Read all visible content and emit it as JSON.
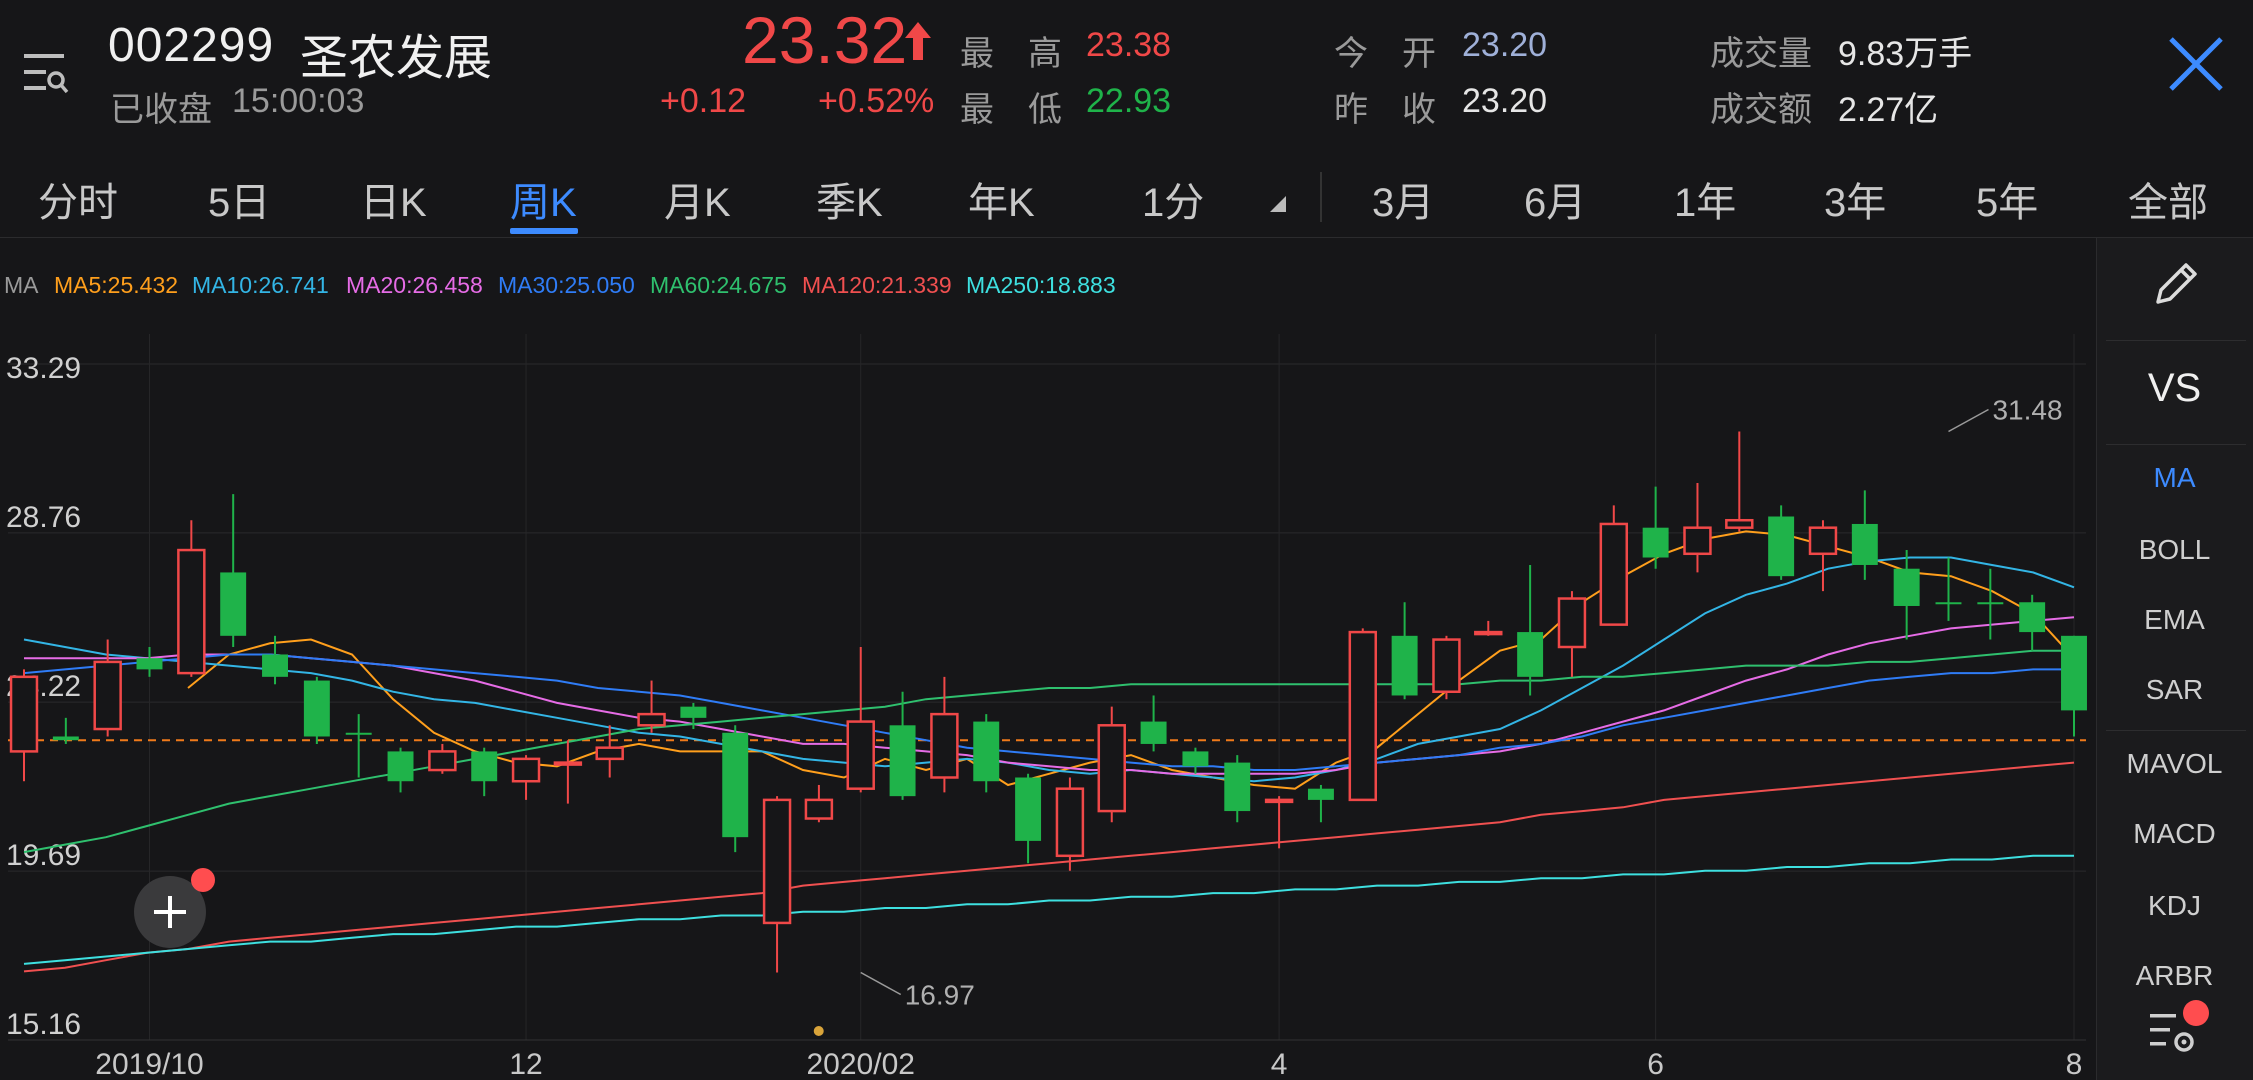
{
  "header": {
    "code": "002299",
    "name": "圣农发展",
    "status": "已收盘",
    "time": "15:00:03",
    "price": "23.32",
    "change": "+0.12",
    "change_pct": "+0.52%",
    "high_label": "最　高",
    "high": "23.38",
    "low_label": "最　低",
    "low": "22.93",
    "open_label": "今　开",
    "open": "23.20",
    "prev_close_label": "昨　收",
    "prev_close": "23.20",
    "volume_label": "成交量",
    "volume": "9.83万手",
    "amount_label": "成交额",
    "amount": "2.27亿"
  },
  "tabs": [
    "分时",
    "5日",
    "日K",
    "周K",
    "月K",
    "季K",
    "年K",
    "1分"
  ],
  "active_tab": "周K",
  "ranges": [
    "3月",
    "6月",
    "1年",
    "3年",
    "5年",
    "全部"
  ],
  "ma_legend": {
    "prefix": "MA",
    "items": [
      {
        "label": "MA5:25.432",
        "color": "#ff9f1c"
      },
      {
        "label": "MA10:26.741",
        "color": "#33b5e5"
      },
      {
        "label": "MA20:26.458",
        "color": "#e66ce6"
      },
      {
        "label": "MA30:25.050",
        "color": "#2f7cf6"
      },
      {
        "label": "MA60:24.675",
        "color": "#2fc06e"
      },
      {
        "label": "MA120:21.339",
        "color": "#f05050"
      },
      {
        "label": "MA250:18.883",
        "color": "#3ee0e0"
      }
    ]
  },
  "side_panel": {
    "vs": "VS",
    "indicators": [
      "MA",
      "BOLL",
      "EMA",
      "SAR",
      "MAVOL",
      "MACD",
      "KDJ",
      "ARBR"
    ],
    "active": "MA"
  },
  "colors": {
    "up": "#f04848",
    "down": "#1fb34a",
    "accent": "#3d8bff",
    "background": "#161618"
  },
  "chart_data": {
    "type": "candlestick",
    "y_ticks": [
      "33.29",
      "28.76",
      "24.22",
      "19.69",
      "15.16"
    ],
    "ylim": [
      15.16,
      33.29
    ],
    "x_ticks": [
      {
        "label": "2019/10",
        "index": 3
      },
      {
        "label": "12",
        "index": 12
      },
      {
        "label": "2020/02",
        "index": 20
      },
      {
        "label": "4",
        "index": 30
      },
      {
        "label": "6",
        "index": 39
      },
      {
        "label": "8",
        "index": 49
      }
    ],
    "reference_price": 23.2,
    "annotations": [
      {
        "text": "31.48",
        "index": 46,
        "value": 31.48
      },
      {
        "text": "16.97",
        "index": 20,
        "value": 16.97
      }
    ],
    "candles": [
      {
        "o": 22.9,
        "c": 24.9,
        "h": 25.1,
        "l": 22.1
      },
      {
        "o": 23.3,
        "c": 23.2,
        "h": 23.8,
        "l": 23.1
      },
      {
        "o": 23.5,
        "c": 25.3,
        "h": 25.9,
        "l": 23.3
      },
      {
        "o": 25.4,
        "c": 25.1,
        "h": 25.7,
        "l": 24.9
      },
      {
        "o": 25.0,
        "c": 28.3,
        "h": 29.1,
        "l": 24.9
      },
      {
        "o": 27.7,
        "c": 26.0,
        "h": 29.8,
        "l": 25.7
      },
      {
        "o": 25.5,
        "c": 24.9,
        "h": 26.0,
        "l": 24.7
      },
      {
        "o": 24.8,
        "c": 23.3,
        "h": 24.9,
        "l": 23.1
      },
      {
        "o": 23.4,
        "c": 23.35,
        "h": 23.9,
        "l": 22.2
      },
      {
        "o": 22.9,
        "c": 22.1,
        "h": 23.0,
        "l": 21.8
      },
      {
        "o": 22.4,
        "c": 22.9,
        "h": 23.1,
        "l": 22.3
      },
      {
        "o": 22.9,
        "c": 22.1,
        "h": 23.0,
        "l": 21.7
      },
      {
        "o": 22.1,
        "c": 22.7,
        "h": 22.8,
        "l": 21.6
      },
      {
        "o": 22.6,
        "c": 22.6,
        "h": 23.2,
        "l": 21.5
      },
      {
        "o": 22.7,
        "c": 23.0,
        "h": 23.6,
        "l": 22.2
      },
      {
        "o": 23.6,
        "c": 23.9,
        "h": 24.8,
        "l": 23.4
      },
      {
        "o": 24.1,
        "c": 23.8,
        "h": 24.2,
        "l": 23.5
      },
      {
        "o": 23.4,
        "c": 20.6,
        "h": 23.6,
        "l": 20.2
      },
      {
        "o": 18.3,
        "c": 21.6,
        "h": 21.7,
        "l": 16.97
      },
      {
        "o": 21.1,
        "c": 21.6,
        "h": 22.0,
        "l": 21.0
      },
      {
        "o": 21.9,
        "c": 23.7,
        "h": 25.7,
        "l": 21.8
      },
      {
        "o": 23.6,
        "c": 21.7,
        "h": 24.5,
        "l": 21.6
      },
      {
        "o": 22.2,
        "c": 23.9,
        "h": 24.9,
        "l": 21.8
      },
      {
        "o": 23.7,
        "c": 22.1,
        "h": 23.9,
        "l": 21.8
      },
      {
        "o": 22.2,
        "c": 20.5,
        "h": 22.3,
        "l": 19.9
      },
      {
        "o": 20.1,
        "c": 21.9,
        "h": 22.2,
        "l": 19.7
      },
      {
        "o": 21.3,
        "c": 23.6,
        "h": 24.1,
        "l": 21.0
      },
      {
        "o": 23.7,
        "c": 23.1,
        "h": 24.4,
        "l": 22.9
      },
      {
        "o": 22.9,
        "c": 22.5,
        "h": 23.0,
        "l": 22.3
      },
      {
        "o": 22.6,
        "c": 21.3,
        "h": 22.8,
        "l": 21.0
      },
      {
        "o": 21.6,
        "c": 21.6,
        "h": 21.7,
        "l": 20.3
      },
      {
        "o": 21.9,
        "c": 21.6,
        "h": 22.0,
        "l": 21.0
      },
      {
        "o": 21.6,
        "c": 26.1,
        "h": 26.2,
        "l": 21.6
      },
      {
        "o": 26.0,
        "c": 24.4,
        "h": 26.9,
        "l": 24.3
      },
      {
        "o": 24.5,
        "c": 25.9,
        "h": 26.0,
        "l": 24.3
      },
      {
        "o": 26.1,
        "c": 26.1,
        "h": 26.4,
        "l": 26.0
      },
      {
        "o": 26.1,
        "c": 24.9,
        "h": 27.9,
        "l": 24.4
      },
      {
        "o": 25.7,
        "c": 27.0,
        "h": 27.2,
        "l": 24.9
      },
      {
        "o": 26.3,
        "c": 29.0,
        "h": 29.5,
        "l": 26.6
      },
      {
        "o": 28.9,
        "c": 28.1,
        "h": 30.0,
        "l": 27.8
      },
      {
        "o": 28.2,
        "c": 28.9,
        "h": 30.1,
        "l": 27.7
      },
      {
        "o": 28.9,
        "c": 29.1,
        "h": 31.48,
        "l": 28.8
      },
      {
        "o": 29.2,
        "c": 27.6,
        "h": 29.5,
        "l": 27.5
      },
      {
        "o": 28.2,
        "c": 28.9,
        "h": 29.1,
        "l": 27.2
      },
      {
        "o": 29.0,
        "c": 27.9,
        "h": 29.9,
        "l": 27.5
      },
      {
        "o": 27.8,
        "c": 26.8,
        "h": 28.3,
        "l": 25.9
      },
      {
        "o": 26.9,
        "c": 26.85,
        "h": 28.1,
        "l": 26.4
      },
      {
        "o": 26.9,
        "c": 26.85,
        "h": 27.8,
        "l": 25.9
      },
      {
        "o": 26.9,
        "c": 26.1,
        "h": 27.1,
        "l": 25.6
      },
      {
        "o": 26.0,
        "c": 24.0,
        "h": 26.0,
        "l": 23.3
      }
    ],
    "series": [
      {
        "name": "MA5",
        "color": "#ff9f1c",
        "values": [
          null,
          null,
          null,
          null,
          24.6,
          25.5,
          25.8,
          25.9,
          25.5,
          24.3,
          23.4,
          22.9,
          22.6,
          22.5,
          22.9,
          23.1,
          22.9,
          22.9,
          22.9,
          22.4,
          22.2,
          22.7,
          22.4,
          22.7,
          22.0,
          22.3,
          22.6,
          22.8,
          22.4,
          22.2,
          22.0,
          21.9,
          22.6,
          23.0,
          23.9,
          24.8,
          25.6,
          25.9,
          26.9,
          27.6,
          28.2,
          28.6,
          28.8,
          28.7,
          28.4,
          28.1,
          27.7,
          27.6,
          27.2,
          26.6,
          25.4
        ]
      },
      {
        "name": "MA10",
        "color": "#33b5e5",
        "values": [
          25.9,
          25.7,
          25.5,
          25.4,
          25.3,
          25.2,
          25.1,
          25.0,
          24.8,
          24.5,
          24.3,
          24.2,
          24.0,
          23.8,
          23.6,
          23.4,
          23.3,
          23.1,
          22.9,
          22.7,
          22.6,
          22.5,
          22.6,
          22.7,
          22.6,
          22.4,
          22.3,
          22.4,
          22.3,
          22.2,
          22.1,
          22.2,
          22.4,
          22.7,
          23.1,
          23.3,
          23.5,
          24.0,
          24.6,
          25.2,
          25.9,
          26.6,
          27.1,
          27.4,
          27.8,
          28.0,
          28.1,
          28.1,
          27.9,
          27.7,
          27.3
        ]
      },
      {
        "name": "MA20",
        "color": "#e66ce6",
        "values": [
          25.4,
          25.4,
          25.4,
          25.4,
          25.5,
          25.5,
          25.5,
          25.4,
          25.3,
          25.2,
          25.0,
          24.8,
          24.5,
          24.2,
          24.0,
          23.8,
          23.7,
          23.5,
          23.3,
          23.1,
          23.1,
          23.0,
          22.9,
          22.8,
          22.6,
          22.5,
          22.4,
          22.4,
          22.3,
          22.3,
          22.3,
          22.3,
          22.4,
          22.6,
          22.7,
          22.8,
          22.9,
          23.1,
          23.4,
          23.7,
          24.0,
          24.4,
          24.8,
          25.1,
          25.5,
          25.8,
          26.0,
          26.2,
          26.3,
          26.4,
          26.5
        ]
      },
      {
        "name": "MA30",
        "color": "#2f7cf6",
        "values": [
          25.0,
          25.1,
          25.2,
          25.3,
          25.4,
          25.5,
          25.5,
          25.4,
          25.3,
          25.2,
          25.1,
          25.0,
          24.9,
          24.8,
          24.6,
          24.5,
          24.4,
          24.2,
          24.0,
          23.8,
          23.6,
          23.4,
          23.2,
          23.0,
          22.9,
          22.8,
          22.7,
          22.6,
          22.5,
          22.5,
          22.4,
          22.4,
          22.5,
          22.6,
          22.7,
          22.8,
          23.0,
          23.1,
          23.3,
          23.6,
          23.8,
          24.0,
          24.2,
          24.4,
          24.6,
          24.8,
          24.9,
          25.0,
          25.0,
          25.1,
          25.1
        ]
      },
      {
        "name": "MA60",
        "color": "#2fc06e",
        "values": [
          20.2,
          20.4,
          20.6,
          20.9,
          21.2,
          21.5,
          21.7,
          21.9,
          22.1,
          22.3,
          22.5,
          22.7,
          22.9,
          23.1,
          23.3,
          23.5,
          23.6,
          23.7,
          23.8,
          23.9,
          24.0,
          24.1,
          24.3,
          24.4,
          24.5,
          24.6,
          24.6,
          24.7,
          24.7,
          24.7,
          24.7,
          24.7,
          24.7,
          24.7,
          24.7,
          24.7,
          24.8,
          24.8,
          24.9,
          24.9,
          25.0,
          25.1,
          25.2,
          25.2,
          25.2,
          25.3,
          25.3,
          25.4,
          25.5,
          25.6,
          25.6
        ]
      },
      {
        "name": "MA120",
        "color": "#f05050",
        "values": [
          17.0,
          17.1,
          17.3,
          17.5,
          17.6,
          17.8,
          17.9,
          18.0,
          18.1,
          18.2,
          18.3,
          18.4,
          18.5,
          18.6,
          18.7,
          18.8,
          18.9,
          19.0,
          19.1,
          19.3,
          19.4,
          19.5,
          19.6,
          19.7,
          19.8,
          19.9,
          20.0,
          20.1,
          20.2,
          20.3,
          20.4,
          20.5,
          20.6,
          20.7,
          20.8,
          20.9,
          21.0,
          21.2,
          21.3,
          21.4,
          21.6,
          21.7,
          21.8,
          21.9,
          22.0,
          22.1,
          22.2,
          22.3,
          22.4,
          22.5,
          22.6
        ]
      },
      {
        "name": "MA250",
        "color": "#3ee0e0",
        "values": [
          17.2,
          17.3,
          17.4,
          17.5,
          17.6,
          17.7,
          17.8,
          17.8,
          17.9,
          18.0,
          18.0,
          18.1,
          18.2,
          18.2,
          18.3,
          18.4,
          18.4,
          18.5,
          18.5,
          18.6,
          18.6,
          18.7,
          18.7,
          18.8,
          18.8,
          18.9,
          18.9,
          19.0,
          19.0,
          19.1,
          19.1,
          19.2,
          19.2,
          19.3,
          19.3,
          19.4,
          19.4,
          19.5,
          19.5,
          19.6,
          19.6,
          19.7,
          19.7,
          19.8,
          19.8,
          19.9,
          19.9,
          20.0,
          20.0,
          20.1,
          20.1
        ]
      }
    ]
  }
}
